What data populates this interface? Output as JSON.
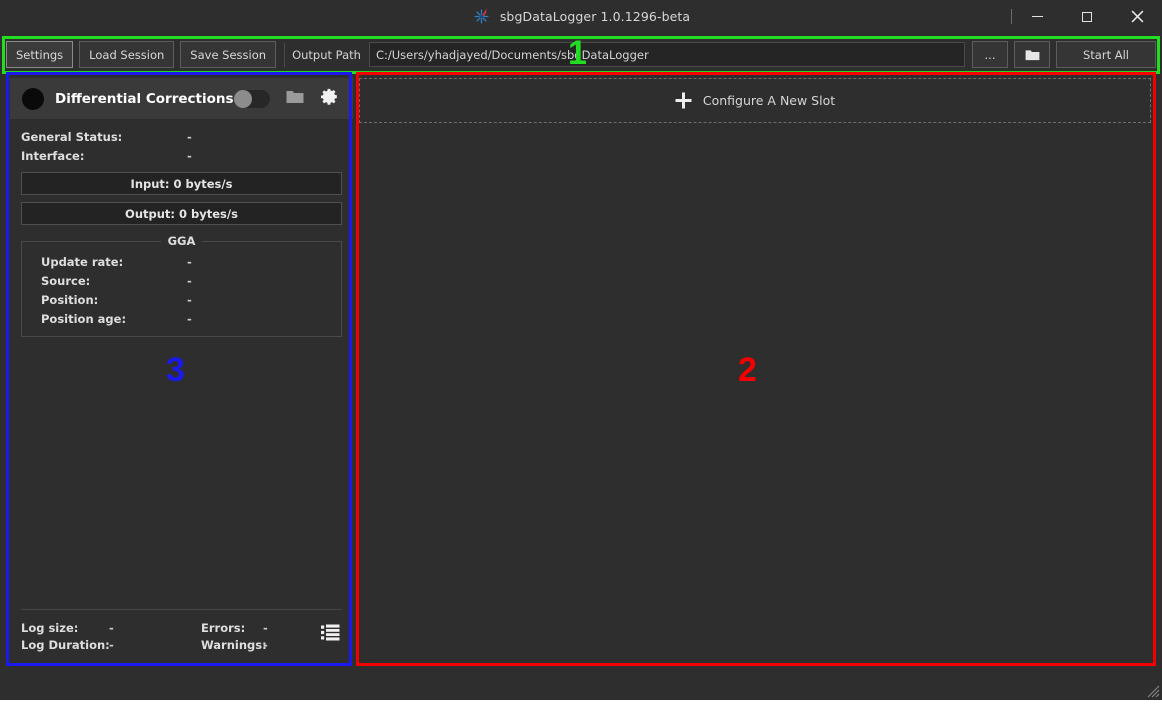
{
  "window": {
    "title": "sbgDataLogger 1.0.1296-beta",
    "logo_icon": "sbg-starburst-logo",
    "controls": {
      "minimize": "minimize-icon",
      "maximize": "maximize-icon",
      "close": "close-icon"
    }
  },
  "toolbar": {
    "settings_label": "Settings",
    "load_session_label": "Load Session",
    "save_session_label": "Save Session",
    "output_path_label": "Output Path",
    "output_path_value": "C:/Users/yhadjayed/Documents/sbgDataLogger",
    "browse_dots_label": "...",
    "open_folder_icon": "folder-icon",
    "start_all_label": "Start All"
  },
  "left_panel": {
    "status_led": "status-led-off",
    "title": "Differential Corrections",
    "toggle_state": "off",
    "folder_icon": "folder-icon",
    "settings_icon": "gear-icon",
    "status_rows": [
      {
        "key": "General Status:",
        "value": "-"
      },
      {
        "key": "Interface:",
        "value": "-"
      }
    ],
    "input_rate": "Input: 0 bytes/s",
    "output_rate": "Output: 0 bytes/s",
    "gga_group": {
      "title": "GGA",
      "rows": [
        {
          "key": "Update rate:",
          "value": "-"
        },
        {
          "key": "Source:",
          "value": "-"
        },
        {
          "key": "Position:",
          "value": "-"
        },
        {
          "key": "Position age:",
          "value": "-"
        }
      ]
    },
    "footer": {
      "log_size_key": "Log size:",
      "log_size_value": "-",
      "log_duration_key": "Log Duration:",
      "log_duration_value": "-",
      "errors_key": "Errors:",
      "errors_value": "-",
      "warnings_key": "Warnings:",
      "warnings_value": "-",
      "log_list_icon": "log-list-icon"
    }
  },
  "right_panel": {
    "new_slot_label": "Configure A New Slot",
    "new_slot_icon": "plus-icon"
  },
  "annotations": [
    {
      "number": "1",
      "color": "#22dd22"
    },
    {
      "number": "2",
      "color": "#f40000"
    },
    {
      "number": "3",
      "color": "#1a1aee"
    }
  ],
  "colors": {
    "background": "#2e2e2e",
    "panel_header": "#3a3a3a",
    "field_background": "#252525",
    "border": "#4a4a4a",
    "text": "#d8d8d8",
    "annotation_green": "#22dd22",
    "annotation_red": "#f40000",
    "annotation_blue": "#1a1aee"
  }
}
